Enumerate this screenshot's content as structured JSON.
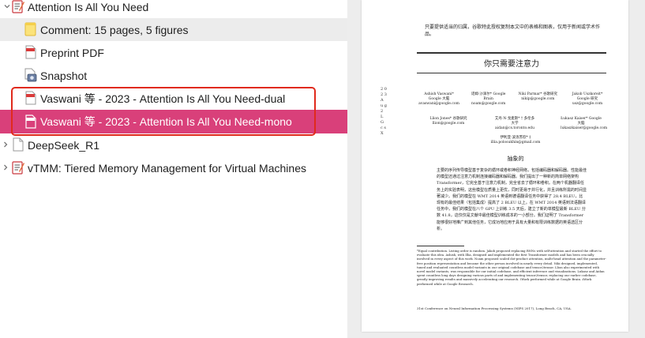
{
  "tree": {
    "items": [
      {
        "label": "Attention Is All You Need",
        "icon": "note-pen-icon",
        "expanded": true
      },
      {
        "label": "Comment: 15 pages, 5 figures",
        "icon": "yellow-note-icon"
      },
      {
        "label": "Preprint PDF",
        "icon": "pdf-icon"
      },
      {
        "label": "Snapshot",
        "icon": "snapshot-icon"
      },
      {
        "label": "Vaswani 等 - 2023 - Attention Is All You Need-dual",
        "icon": "pdf-icon"
      },
      {
        "label": "Vaswani 等 - 2023 - Attention Is All You Need-mono",
        "icon": "pdf-icon"
      },
      {
        "label": "DeepSeek_R1",
        "icon": "document-icon",
        "expanded": false
      },
      {
        "label": "vTMM: Tiered Memory Management for Virtual Machines",
        "icon": "note-pen-icon",
        "expanded": false
      }
    ],
    "colors": {
      "selected_pink": "#d9407a",
      "selected_grey": "#ececec",
      "highlight_box": "#e02a1c"
    }
  },
  "preview": {
    "notice": "只要提供适当的归属，谷歌特此授权复制本文中的表格和图表，仅用于新闻或学术作品。",
    "title": "你只需要注意力",
    "authors_row1": [
      "Ashish Vaswani* Google 大脑 avaswani@google.com",
      "诺姆·沙泽尔* Google Brain noam@google.com",
      "Niki Parmar* 谷歌研究 nikip@google.com",
      "Jakob Uszkoreit* Google 研究 usz@google.com"
    ],
    "authors_row2": [
      "Llion Jones* 谷歌研究 llion@google.com",
      "艾丹·N·戈麦斯* † 多伦多大学 aidan@cs.toronto.edu",
      "Łukasz Kaiser* Google 大脑 lukaszkaiser@google.com"
    ],
    "illia": "伊利亚·波洛苏欣* ‡ illia.polosukhin@gmail.com",
    "abstract_heading": "抽象的",
    "abstract": "主要的序列传导模型基于复杂的循环或卷积神经网络，包括编码器和解码器。性能最佳的模型还通过注意力机制连接编码器和解码器。我们提出了一种新的简单网络架构 Transformer，它完全基于注意力机制，完全省去了循环和卷积。在两个机器翻译任务上的实验表明，这些模型在质量上更优，同时更易于并行化，并且训练所需的时间显著减少。我们的模型在 WMT 2014 英语到德语翻译任务中获得了 28.4 BLEU，比现有的最佳结果（包括集成）提高了 2 BLEU 以上。在 WMT 2014 英语到法语翻译任务中，我们的模型在八个 GPU 上训练 3.5 天后，建立了新的单模型最新 BLEU 分数 41.8，这仅仅是文献中最佳模型训练成本的一小部分。我们证明了 Transformer 能够很好地推广到其他任务，它成功地应用于具有大量和有限训练数据的英语选区分析。",
    "footnotes": "*Equal contribution. Listing order is random. Jakob proposed replacing RNNs with self-attention and started the effort to evaluate this idea. Ashish, with Illia, designed and implemented the first Transformer models and has been crucially involved in every aspect of this work. Noam proposed scaled dot-product attention, multi-head attention and the parameter-free position representation and became the other person involved in nearly every detail. Niki designed, implemented, tuned and evaluated countless model variants in our original codebase and tensor2tensor. Llion also experimented with novel model variants, was responsible for our initial codebase, and efficient inference and visualizations. Lukasz and Aidan spent countless long days designing various parts of and implementing tensor2tensor, replacing our earlier codebase, greatly improving results and massively accelerating our research. †Work performed while at Google Brain. ‡Work performed while at Google Research.",
    "conference": "31st Conference on Neural Information Processing Systems (NIPS 2017), Long Beach, CA, USA.",
    "margin": "2 0 2 3 A u g 2 L G c s X"
  }
}
